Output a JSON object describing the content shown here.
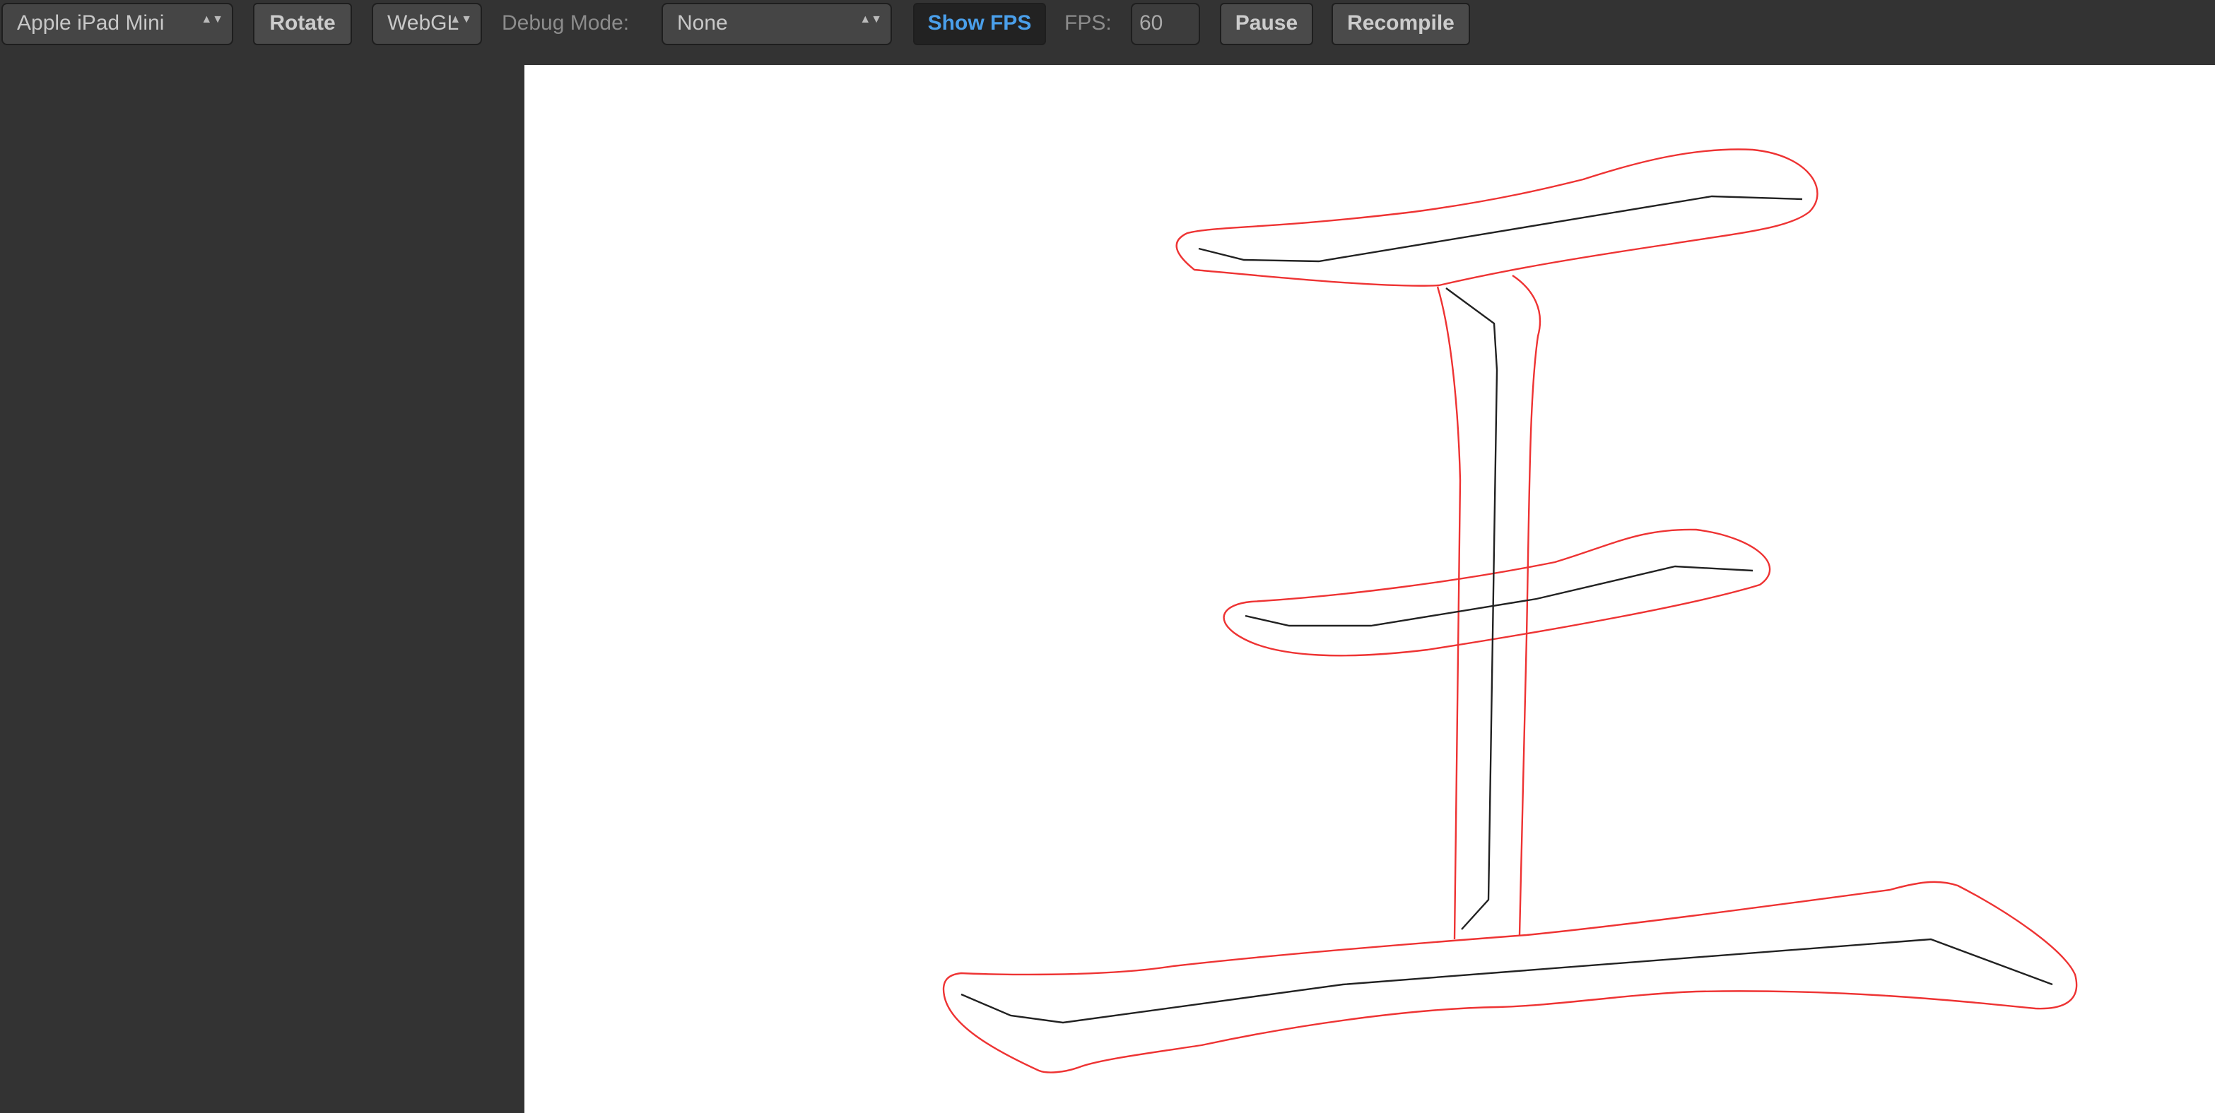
{
  "toolbar": {
    "device_select": "Apple iPad Mini",
    "rotate_label": "Rotate",
    "renderer_select": "WebGL",
    "debug_mode_label": "Debug Mode:",
    "debug_mode_select": "None",
    "show_fps_label": "Show FPS",
    "fps_label": "FPS:",
    "fps_value": "60",
    "pause_label": "Pause",
    "recompile_label": "Recompile",
    "show_fps_color": "#4a9fea"
  },
  "canvas": {
    "outline_color": "#ee3333",
    "centerline_color": "#222222"
  }
}
